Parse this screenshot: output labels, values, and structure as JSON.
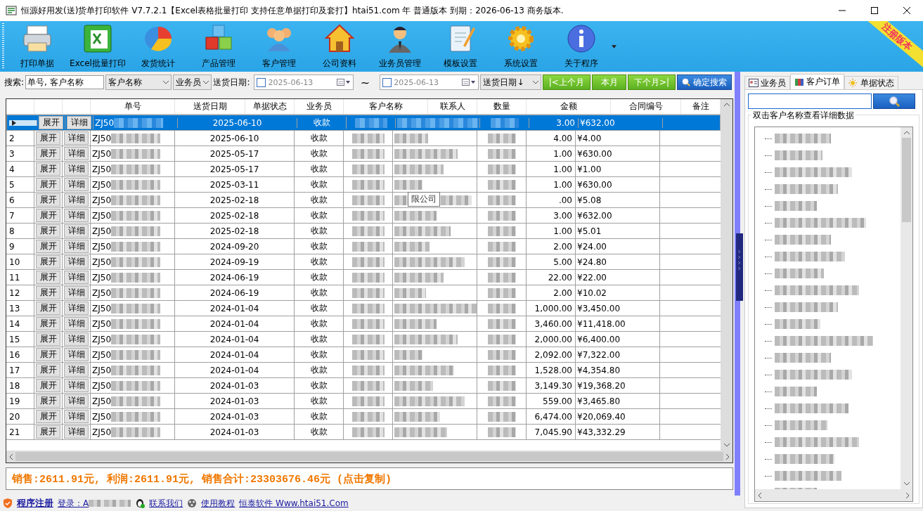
{
  "window": {
    "title": "恒源好用发(送)货单打印软件 V7.7.2.1【Excel表格批量打印 支持任意单据打印及套打】htai51.com  年 普通版本   到期：2026-06-13  商务版本."
  },
  "toolbar": {
    "items": [
      {
        "label": "打印单据"
      },
      {
        "label": "Excel批量打印"
      },
      {
        "label": "发货统计"
      },
      {
        "label": "产品管理"
      },
      {
        "label": "客户管理"
      },
      {
        "label": "公司资料"
      },
      {
        "label": "业务员管理"
      },
      {
        "label": "模板设置"
      },
      {
        "label": "系统设置"
      },
      {
        "label": "关于程序"
      }
    ],
    "ribbon": "注册版本"
  },
  "search": {
    "label": "搜索:",
    "value": "单号, 客户名称",
    "field_select": "客户名称",
    "salesperson_select": "业务员",
    "date_label": "送货日期:",
    "date_from": {
      "checked": false,
      "value": "2025-06-13"
    },
    "tilde": "~",
    "date_to": {
      "checked": false,
      "value": "2025-06-13"
    },
    "sort_select": "送货日期↓",
    "month_buttons": [
      "|<上个月",
      "本月",
      "下个月>|"
    ],
    "search_button": "确定搜索"
  },
  "table": {
    "columns": [
      "",
      "",
      "",
      "单号",
      "送货日期",
      "单据状态",
      "业务员",
      "客户名称",
      "联系人",
      "数量",
      "金额",
      "合同编号",
      "备注"
    ],
    "rows": [
      {
        "no": "",
        "expand": "展开",
        "detail": "详细",
        "order": "ZJ50",
        "date": "2025-06-10",
        "status": "收款",
        "qty": "3.00",
        "amount": "¥632.00",
        "selected": true
      },
      {
        "no": "2",
        "expand": "展开",
        "detail": "详细",
        "order": "ZJ50",
        "date": "2025-06-10",
        "status": "收款",
        "qty": "4.00",
        "amount": "¥4.00",
        "selected": false
      },
      {
        "no": "3",
        "expand": "展开",
        "detail": "详细",
        "order": "ZJ50",
        "date": "2025-05-17",
        "status": "收款",
        "qty": "1.00",
        "amount": "¥630.00",
        "selected": false
      },
      {
        "no": "4",
        "expand": "展开",
        "detail": "详细",
        "order": "ZJ50",
        "date": "2025-05-17",
        "status": "收款",
        "qty": "1.00",
        "amount": "¥1.00",
        "selected": false
      },
      {
        "no": "5",
        "expand": "展开",
        "detail": "详细",
        "order": "ZJ50",
        "date": "2025-03-11",
        "status": "收款",
        "qty": "1.00",
        "amount": "¥630.00",
        "selected": false
      },
      {
        "no": "6",
        "expand": "展开",
        "detail": "详细",
        "order": "ZJ50",
        "date": "2025-02-18",
        "status": "收款",
        "qty": ".00",
        "amount": "¥5.08",
        "selected": false
      },
      {
        "no": "7",
        "expand": "展开",
        "detail": "详细",
        "order": "ZJ50",
        "date": "2025-02-18",
        "status": "收款",
        "qty": "3.00",
        "amount": "¥632.00",
        "selected": false
      },
      {
        "no": "8",
        "expand": "展开",
        "detail": "详细",
        "order": "ZJ50",
        "date": "2025-02-18",
        "status": "收款",
        "qty": "1.00",
        "amount": "¥5.01",
        "selected": false
      },
      {
        "no": "9",
        "expand": "展开",
        "detail": "详细",
        "order": "ZJ50",
        "date": "2024-09-20",
        "status": "收款",
        "qty": "2.00",
        "amount": "¥24.00",
        "selected": false
      },
      {
        "no": "10",
        "expand": "展开",
        "detail": "详细",
        "order": "ZJ50",
        "date": "2024-09-19",
        "status": "收款",
        "qty": "5.00",
        "amount": "¥24.80",
        "selected": false
      },
      {
        "no": "11",
        "expand": "展开",
        "detail": "详细",
        "order": "ZJ50",
        "date": "2024-06-19",
        "status": "收款",
        "qty": "22.00",
        "amount": "¥22.00",
        "selected": false
      },
      {
        "no": "12",
        "expand": "展开",
        "detail": "详细",
        "order": "ZJ50",
        "date": "2024-06-19",
        "status": "收款",
        "qty": "2.00",
        "amount": "¥10.02",
        "selected": false
      },
      {
        "no": "13",
        "expand": "展开",
        "detail": "详细",
        "order": "ZJ50",
        "date": "2024-01-04",
        "status": "收款",
        "qty": "1,000.00",
        "amount": "¥3,450.00",
        "selected": false
      },
      {
        "no": "14",
        "expand": "展开",
        "detail": "详细",
        "order": "ZJ50",
        "date": "2024-01-04",
        "status": "收款",
        "qty": "3,460.00",
        "amount": "¥11,418.00",
        "selected": false
      },
      {
        "no": "15",
        "expand": "展开",
        "detail": "详细",
        "order": "ZJ50",
        "date": "2024-01-04",
        "status": "收款",
        "qty": "2,000.00",
        "amount": "¥6,400.00",
        "selected": false
      },
      {
        "no": "16",
        "expand": "展开",
        "detail": "详细",
        "order": "ZJ50",
        "date": "2024-01-04",
        "status": "收款",
        "qty": "2,092.00",
        "amount": "¥7,322.00",
        "selected": false
      },
      {
        "no": "17",
        "expand": "展开",
        "detail": "详细",
        "order": "ZJ50",
        "date": "2024-01-04",
        "status": "收款",
        "qty": "1,528.00",
        "amount": "¥4,354.80",
        "selected": false
      },
      {
        "no": "18",
        "expand": "展开",
        "detail": "详细",
        "order": "ZJ50",
        "date": "2024-01-03",
        "status": "收款",
        "qty": "3,149.30",
        "amount": "¥19,368.20",
        "selected": false
      },
      {
        "no": "19",
        "expand": "展开",
        "detail": "详细",
        "order": "ZJ50",
        "date": "2024-01-03",
        "status": "收款",
        "qty": "559.00",
        "amount": "¥3,465.80",
        "selected": false
      },
      {
        "no": "20",
        "expand": "展开",
        "detail": "详细",
        "order": "ZJ50",
        "date": "2024-01-03",
        "status": "收款",
        "qty": "6,474.00",
        "amount": "¥20,069.40",
        "selected": false
      },
      {
        "no": "21",
        "expand": "展开",
        "detail": "详细",
        "order": "ZJ50",
        "date": "2024-01-03",
        "status": "收款",
        "qty": "7,045.90",
        "amount": "¥43,332.29",
        "selected": false
      }
    ],
    "tooltip": "限公司"
  },
  "summary": "销售:2611.91元, 利润:2611.91元, 销售合计:23303676.46元 (点击复制)",
  "status_bar": {
    "register": "程序注册",
    "login": "登录：A",
    "contact": "联系我们",
    "tutorial": "使用教程",
    "website": "恒泰软件 Www.htai51.Com"
  },
  "side_panel": {
    "tabs": [
      {
        "label": "业务员",
        "selected": false
      },
      {
        "label": "客户订单",
        "selected": true
      },
      {
        "label": "单据状态",
        "selected": false
      }
    ],
    "group_title": "双击客户名称查看详细数据"
  }
}
